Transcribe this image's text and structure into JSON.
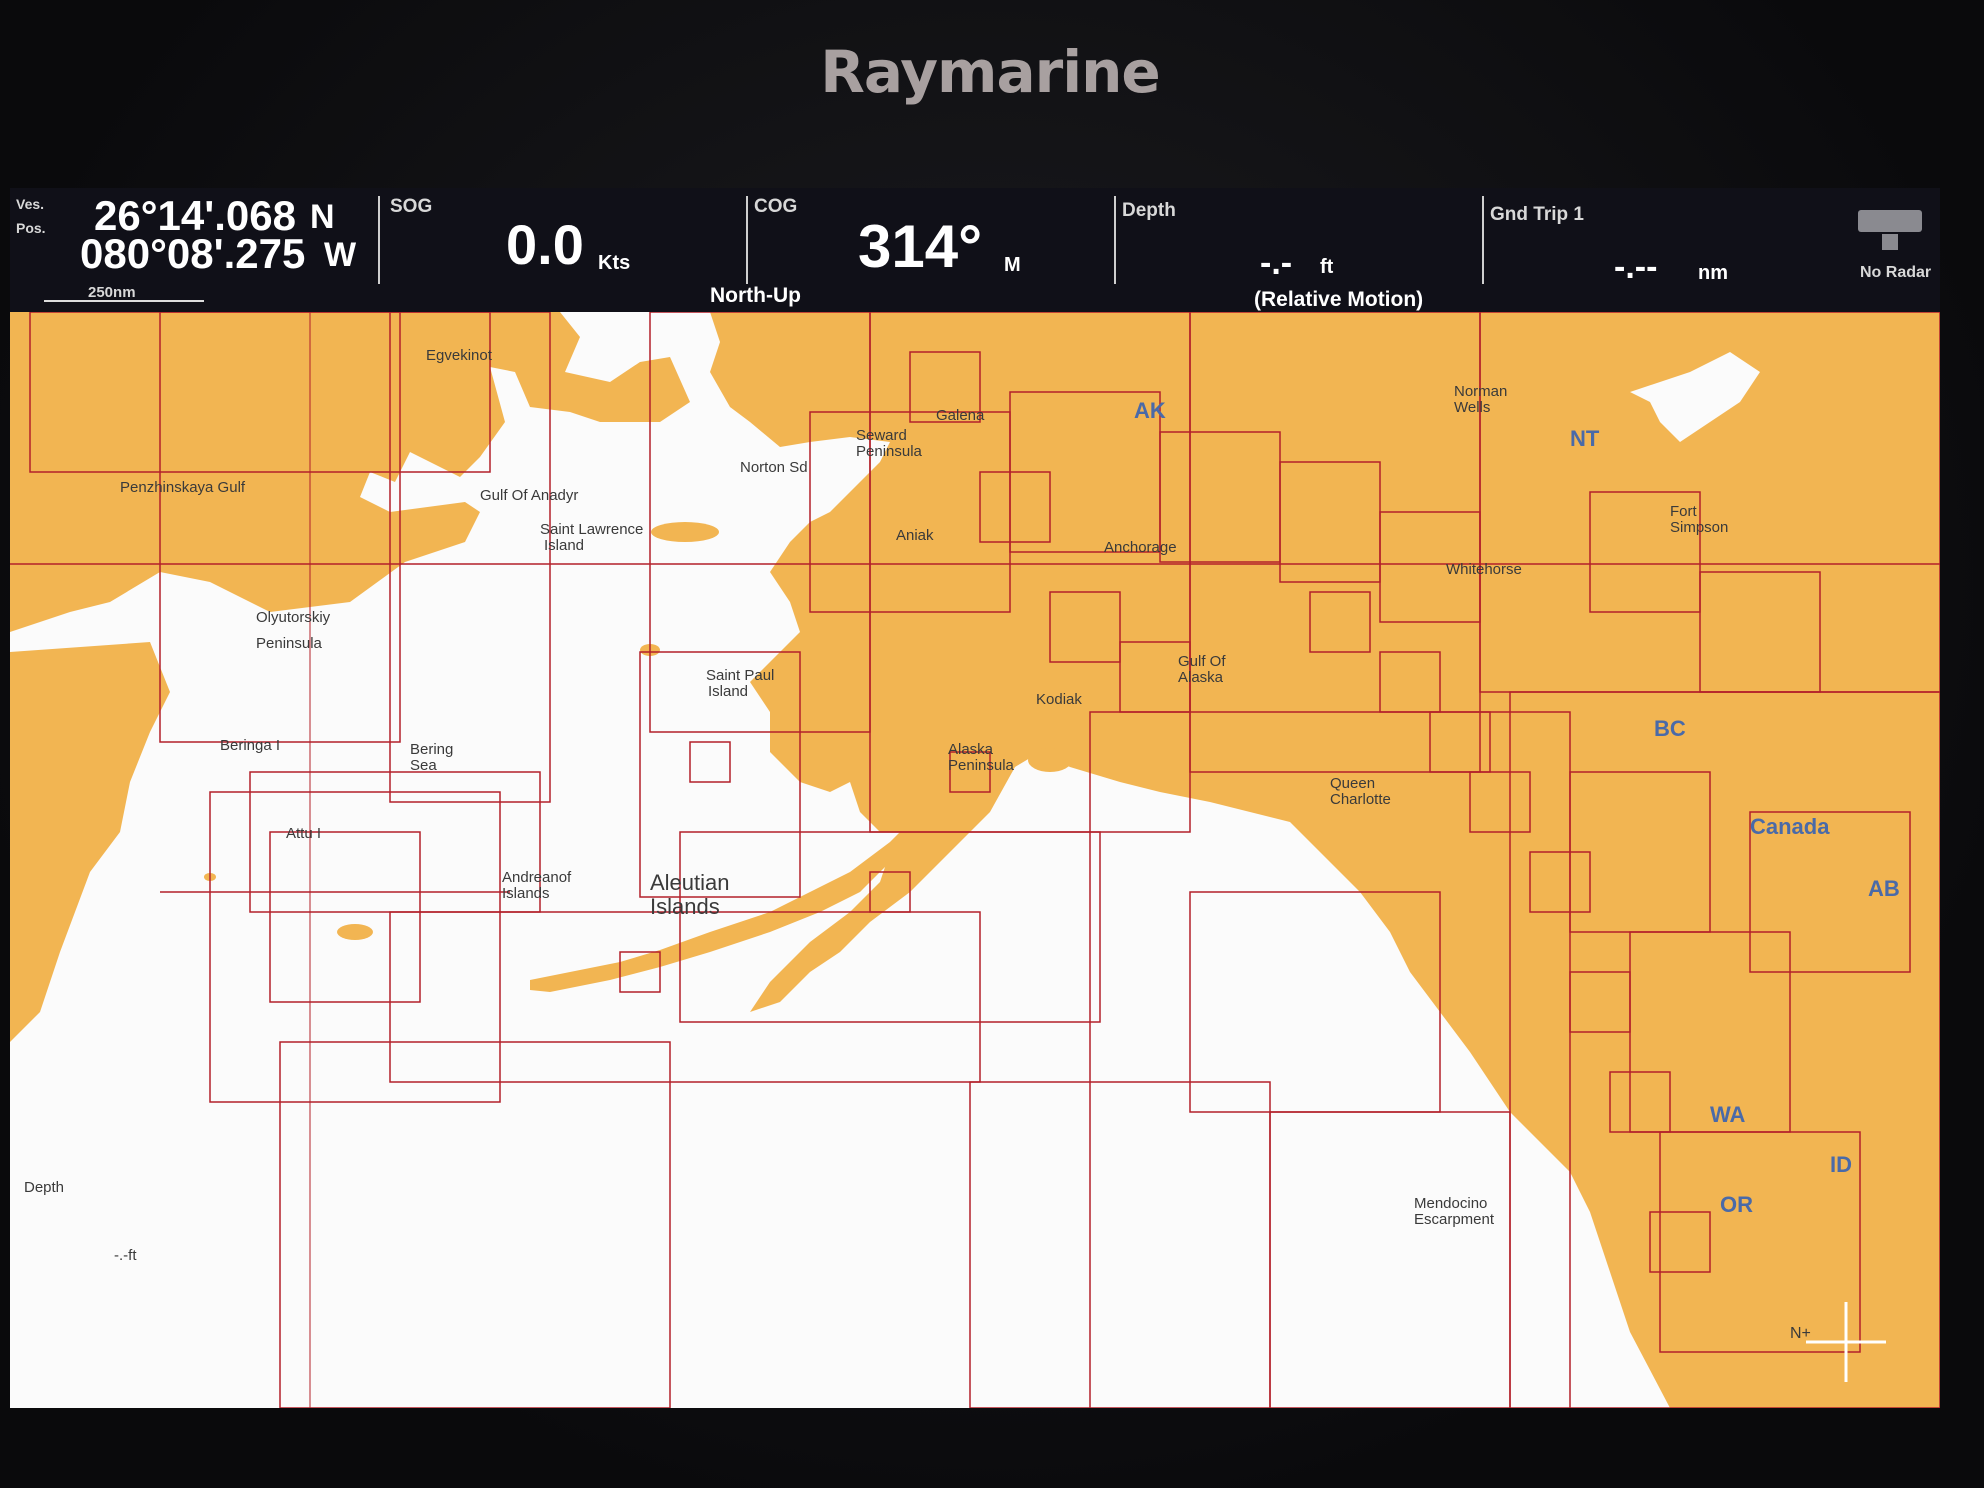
{
  "device": {
    "brand": "Raymarine"
  },
  "databar": {
    "position": {
      "label_top": "Ves.",
      "label_bottom": "Pos.",
      "lat": "26°14'.068",
      "lat_hemi": "N",
      "lon": "080°08'.275",
      "lon_hemi": "W",
      "scale": "250nm"
    },
    "sog": {
      "label": "SOG",
      "value": "0.0",
      "unit": "Kts"
    },
    "cog": {
      "label": "COG",
      "value": "314°",
      "unit": "M",
      "mode": "North-Up"
    },
    "depth": {
      "label": "Depth",
      "value": "-.-",
      "unit": "ft",
      "motion": "(Relative Motion)"
    },
    "trip": {
      "label": "Gnd Trip 1",
      "value": "-.--",
      "unit": "nm"
    },
    "radar": {
      "status": "No Radar"
    }
  },
  "map": {
    "colors": {
      "land": "#f2b552",
      "sea": "#fbfbfb",
      "chart_border": "#b3202a",
      "region_label": "#4a6aa8"
    },
    "places": [
      {
        "id": "egvekinot",
        "text": "Egvekinot"
      },
      {
        "id": "penzhinskaya",
        "text": "Penzhinskaya Gulf"
      },
      {
        "id": "anadyr",
        "text": "Gulf Of Anadyr"
      },
      {
        "id": "stlawrence1",
        "text": "Saint Lawrence"
      },
      {
        "id": "stlawrence2",
        "text": "Island"
      },
      {
        "id": "norton",
        "text": "Norton Sd"
      },
      {
        "id": "seward1",
        "text": "Seward"
      },
      {
        "id": "seward2",
        "text": "Peninsula"
      },
      {
        "id": "galena",
        "text": "Galena"
      },
      {
        "id": "aniak",
        "text": "Aniak"
      },
      {
        "id": "anchorage",
        "text": "Anchorage"
      },
      {
        "id": "olyutorskiy1",
        "text": "Olyutorskiy"
      },
      {
        "id": "olyutorskiy2",
        "text": "Peninsula"
      },
      {
        "id": "stpaul1",
        "text": "Saint Paul"
      },
      {
        "id": "stpaul2",
        "text": "Island"
      },
      {
        "id": "gulfalaska1",
        "text": "Gulf Of"
      },
      {
        "id": "gulfalaska2",
        "text": "Alaska"
      },
      {
        "id": "kodiak",
        "text": "Kodiak"
      },
      {
        "id": "alaskapen1",
        "text": "Alaska"
      },
      {
        "id": "alaskapen2",
        "text": "Peninsula"
      },
      {
        "id": "beringa",
        "text": "Beringa I"
      },
      {
        "id": "beringsea1",
        "text": "Bering"
      },
      {
        "id": "beringsea2",
        "text": "Sea"
      },
      {
        "id": "attu",
        "text": "Attu I"
      },
      {
        "id": "andreanof1",
        "text": "Andreanof"
      },
      {
        "id": "andreanof2",
        "text": "Islands"
      },
      {
        "id": "queen1",
        "text": "Queen"
      },
      {
        "id": "queen2",
        "text": "Charlotte"
      },
      {
        "id": "normanwells1",
        "text": "Norman"
      },
      {
        "id": "normanwells2",
        "text": "Wells"
      },
      {
        "id": "fortsimpson1",
        "text": "Fort"
      },
      {
        "id": "fortsimpson2",
        "text": "Simpson"
      },
      {
        "id": "whitehorse",
        "text": "Whitehorse"
      },
      {
        "id": "mendocino1",
        "text": "Mendocino"
      },
      {
        "id": "mendocino2",
        "text": "Escarpment"
      },
      {
        "id": "depthcorner",
        "text": "Depth"
      },
      {
        "id": "depthval",
        "text": "-.-ft"
      }
    ],
    "aleutian": {
      "line1": "Aleutian",
      "line2": "Islands"
    },
    "regions": [
      {
        "id": "ak",
        "text": "AK"
      },
      {
        "id": "nt",
        "text": "NT"
      },
      {
        "id": "bc",
        "text": "BC"
      },
      {
        "id": "canada",
        "text": "Canada"
      },
      {
        "id": "ab",
        "text": "AB"
      },
      {
        "id": "wa",
        "text": "WA"
      },
      {
        "id": "id",
        "text": "ID"
      },
      {
        "id": "or",
        "text": "OR"
      }
    ],
    "compass": {
      "label": "N+"
    }
  }
}
